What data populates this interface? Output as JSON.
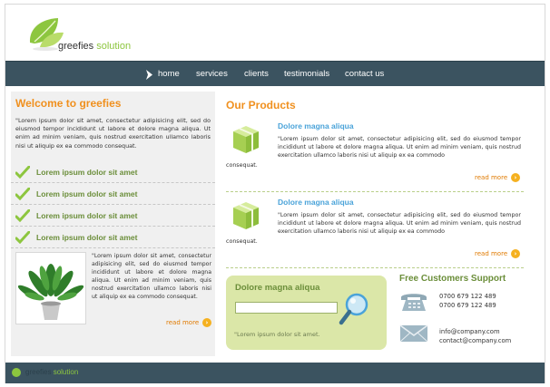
{
  "brand": {
    "name_part1": "greefies",
    "name_part2": " solution"
  },
  "nav": {
    "items": [
      "home",
      "services",
      "clients",
      "testimonials",
      "contact us"
    ],
    "active": "home"
  },
  "welcome": {
    "title": "Welcome to greefies",
    "intro": "\"Lorem ipsum dolor sit amet, consectetur adipisicing elit, sed do eiusmod tempor incididunt ut labore et dolore magna aliqua. Ut enim ad minim veniam, quis nostrud exercitation ullamco laboris nisi ut aliquip ex ea commodo consequat.",
    "checks": [
      "Lorem ipsum dolor sit amet",
      "Lorem ipsum dolor sit amet",
      "Lorem ipsum dolor sit amet",
      "Lorem ipsum dolor sit amet"
    ],
    "plant_text": "\"Lorem ipsum dolor sit amet, consectetur adipisicing elit, sed do eiusmod tempor incididunt ut labore et dolore magna aliqua. Ut enim ad minim veniam, quis nostrud exercitation ullamco laboris nisi ut aliquip ex ea commodo consequat.",
    "read_more": "read more"
  },
  "products": {
    "title": "Our Products",
    "items": [
      {
        "title": "Dolore magna aliqua",
        "text": "\"Lorem ipsum dolor sit amet, consectetur adipisicing elit, sed do eiusmod tempor incididunt ut labore et dolore magna aliqua. Ut enim ad minim veniam, quis nostrud exercitation ullamco laboris nisi ut aliquip ex ea commodo",
        "tail": "consequat.",
        "read_more": "read more"
      },
      {
        "title": "Dolore magna aliqua",
        "text": "\"Lorem ipsum dolor sit amet, consectetur adipisicing elit, sed do eiusmod tempor incididunt ut labore et dolore magna aliqua. Ut enim ad minim veniam, quis nostrud exercitation ullamco laboris nisi ut aliquip ex ea commodo",
        "tail": "consequat.",
        "read_more": "read more"
      }
    ]
  },
  "search": {
    "title": "Dolore magna aliqua",
    "value": "",
    "note": "\"Lorem ipsum dolor sit amet."
  },
  "support": {
    "title": "Free Customers Support",
    "phones": [
      "0700 679 122 489",
      "0700 679 122 489"
    ],
    "emails": [
      "info@company.com",
      "contact@company.com"
    ]
  },
  "footer": {
    "name_part1": "greefies",
    "name_part2": " solution"
  },
  "colors": {
    "accent": "#f0901e",
    "green": "#8dc63f",
    "nav": "#3b5360",
    "link": "#4aa3d9"
  }
}
